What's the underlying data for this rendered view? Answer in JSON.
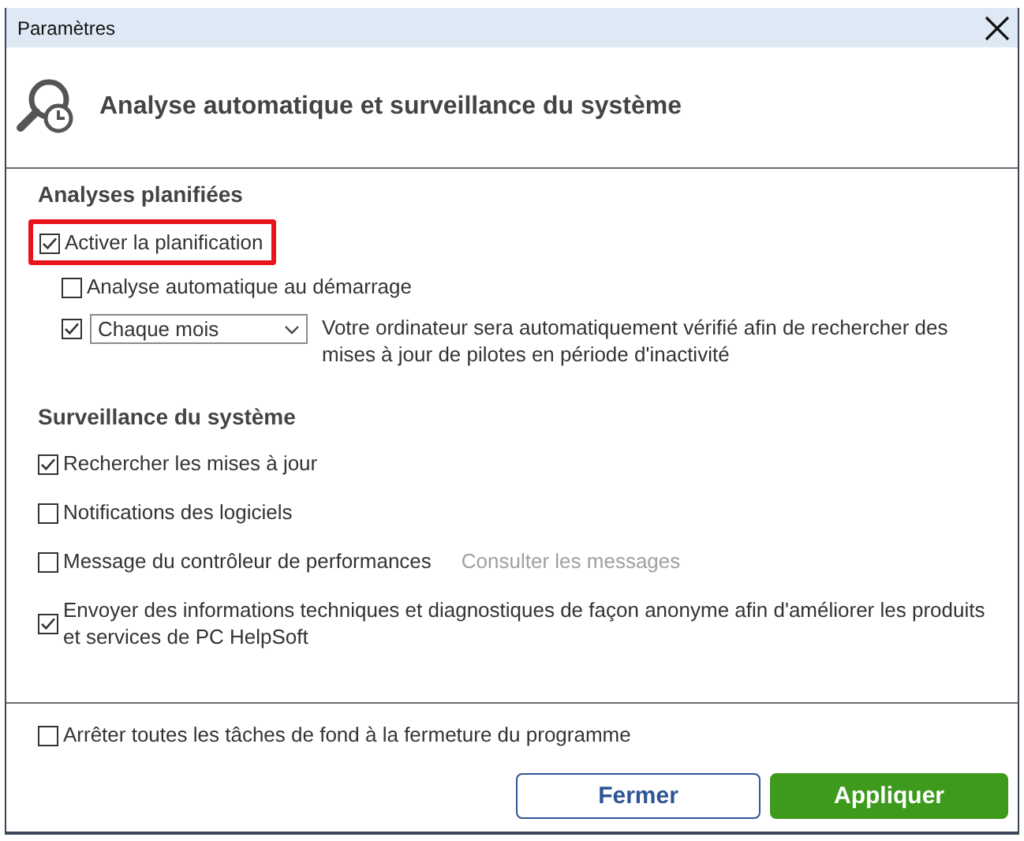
{
  "window": {
    "title": "Paramètres"
  },
  "header": {
    "title": "Analyse automatique et surveillance du système"
  },
  "sections": [
    {
      "heading": "Analyses planifiées",
      "items": [
        {
          "kind": "checkbox",
          "label": "Activer la planification",
          "checked": true,
          "highlighted": true,
          "children": [
            {
              "kind": "checkbox",
              "label": "Analyse automatique au démarrage",
              "checked": false
            },
            {
              "kind": "schedule",
              "checked": true,
              "dropdown": {
                "value": "Chaque mois"
              },
              "description": "Votre ordinateur sera automatiquement vérifié afin de rechercher des mises à jour de pilotes en période d'inactivité"
            }
          ]
        }
      ]
    },
    {
      "heading": "Surveillance du système",
      "items": [
        {
          "kind": "checkbox",
          "label": "Rechercher les mises à jour",
          "checked": true
        },
        {
          "kind": "checkbox",
          "label": "Notifications des logiciels",
          "checked": false
        },
        {
          "kind": "checkbox",
          "label": "Message du contrôleur de performances",
          "checked": false,
          "link": {
            "label": "Consulter les messages",
            "disabled": true
          }
        },
        {
          "kind": "checkbox",
          "label": "Envoyer des informations techniques et diagnostiques de façon anonyme afin d'améliorer les produits et services de PC HelpSoft",
          "checked": true
        }
      ]
    }
  ],
  "footer": {
    "items": [
      {
        "kind": "checkbox",
        "label": "Arrêter toutes les tâches de fond à la fermeture du programme",
        "checked": false
      }
    ],
    "buttons": [
      {
        "label": "Fermer",
        "kind": "secondary"
      },
      {
        "label": "Appliquer",
        "kind": "primary"
      }
    ]
  }
}
